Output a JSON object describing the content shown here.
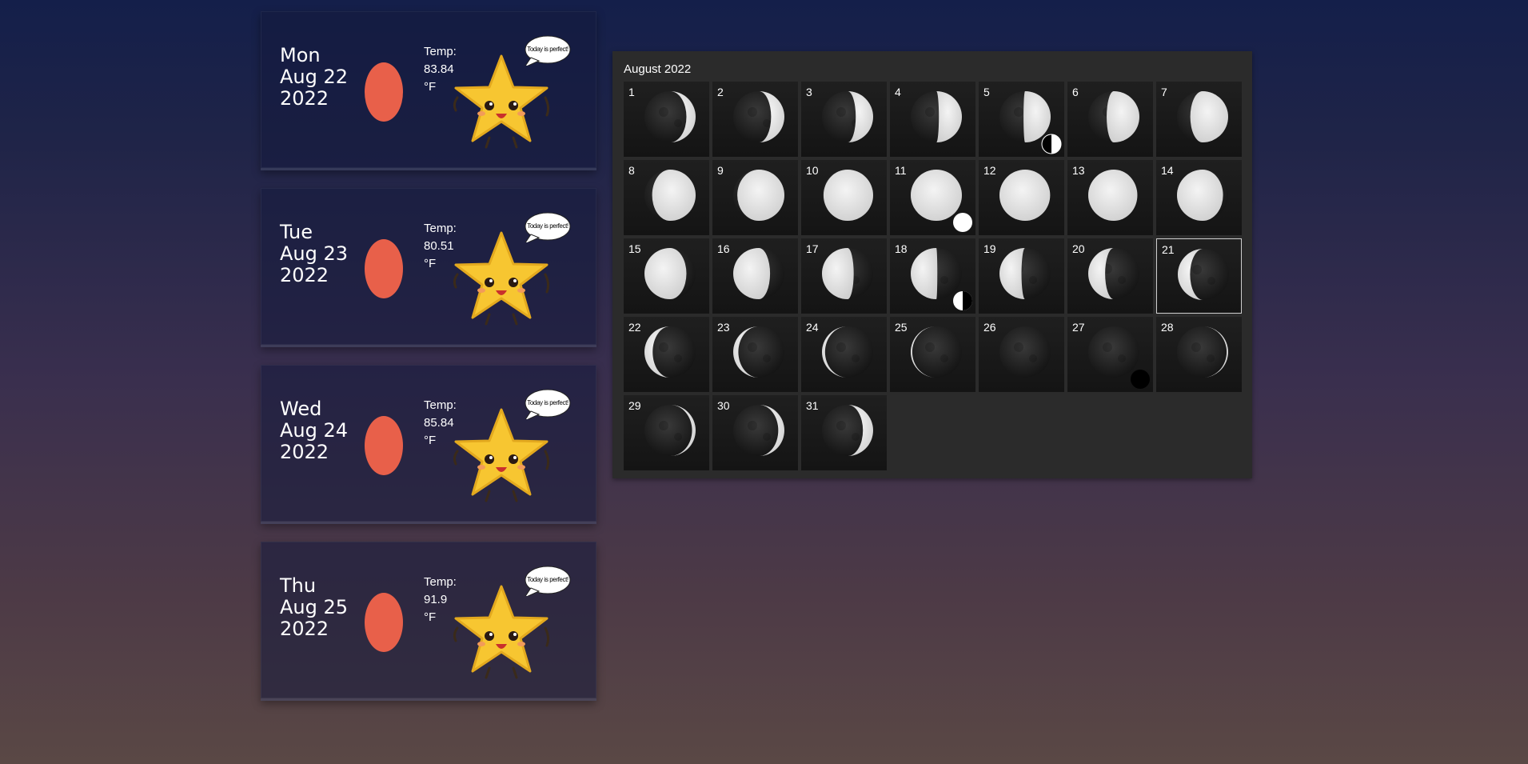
{
  "forecast": [
    {
      "day": "Mon",
      "date": "Aug 22",
      "year": "2022",
      "temp_label": "Temp:",
      "temp_value": "83.84",
      "temp_unit": "°F",
      "speech": "Today is perfect!"
    },
    {
      "day": "Tue",
      "date": "Aug 23",
      "year": "2022",
      "temp_label": "Temp:",
      "temp_value": "80.51",
      "temp_unit": "°F",
      "speech": "Today is perfect!"
    },
    {
      "day": "Wed",
      "date": "Aug 24",
      "year": "2022",
      "temp_label": "Temp:",
      "temp_value": "85.84",
      "temp_unit": "°F",
      "speech": "Today is perfect!"
    },
    {
      "day": "Thu",
      "date": "Aug 25",
      "year": "2022",
      "temp_label": "Temp:",
      "temp_value": "91.9",
      "temp_unit": "°F",
      "speech": "Today is perfect!"
    }
  ],
  "colors": {
    "sun": "#e8604a",
    "star": "#f7c631",
    "panel": "#2b2b2b"
  },
  "calendar": {
    "title": "August 2022",
    "today": "21",
    "days": [
      {
        "n": "1",
        "illum": 0.18,
        "waxing": true
      },
      {
        "n": "2",
        "illum": 0.26,
        "waxing": true
      },
      {
        "n": "3",
        "illum": 0.34,
        "waxing": true
      },
      {
        "n": "4",
        "illum": 0.45,
        "waxing": true
      },
      {
        "n": "5",
        "illum": 0.53,
        "waxing": true,
        "marker": "first-quarter"
      },
      {
        "n": "6",
        "illum": 0.64,
        "waxing": true
      },
      {
        "n": "7",
        "illum": 0.74,
        "waxing": true
      },
      {
        "n": "8",
        "illum": 0.85,
        "waxing": true
      },
      {
        "n": "9",
        "illum": 0.92,
        "waxing": true
      },
      {
        "n": "10",
        "illum": 0.97,
        "waxing": true
      },
      {
        "n": "11",
        "illum": 1.0,
        "waxing": true,
        "marker": "full"
      },
      {
        "n": "12",
        "illum": 0.99,
        "waxing": false
      },
      {
        "n": "13",
        "illum": 0.96,
        "waxing": false
      },
      {
        "n": "14",
        "illum": 0.9,
        "waxing": false
      },
      {
        "n": "15",
        "illum": 0.82,
        "waxing": false
      },
      {
        "n": "16",
        "illum": 0.72,
        "waxing": false
      },
      {
        "n": "17",
        "illum": 0.62,
        "waxing": false
      },
      {
        "n": "18",
        "illum": 0.52,
        "waxing": false,
        "marker": "last-quarter"
      },
      {
        "n": "19",
        "illum": 0.43,
        "waxing": false
      },
      {
        "n": "20",
        "illum": 0.33,
        "waxing": false
      },
      {
        "n": "21",
        "illum": 0.24,
        "waxing": false
      },
      {
        "n": "22",
        "illum": 0.16,
        "waxing": false
      },
      {
        "n": "23",
        "illum": 0.1,
        "waxing": false
      },
      {
        "n": "24",
        "illum": 0.06,
        "waxing": false
      },
      {
        "n": "25",
        "illum": 0.03,
        "waxing": false
      },
      {
        "n": "26",
        "illum": 0.0,
        "waxing": false
      },
      {
        "n": "27",
        "illum": 0.0,
        "waxing": false,
        "marker": "new"
      },
      {
        "n": "28",
        "illum": 0.03,
        "waxing": true
      },
      {
        "n": "29",
        "illum": 0.07,
        "waxing": true
      },
      {
        "n": "30",
        "illum": 0.12,
        "waxing": true
      },
      {
        "n": "31",
        "illum": 0.2,
        "waxing": true
      }
    ]
  }
}
